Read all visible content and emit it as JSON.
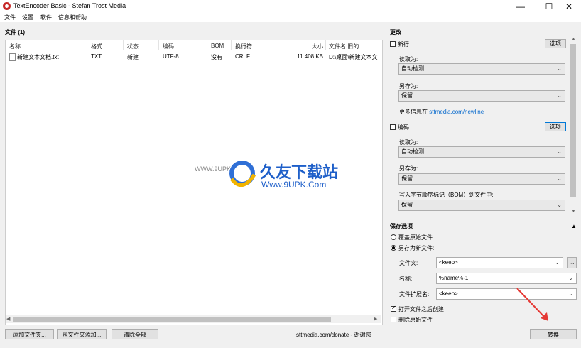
{
  "window": {
    "title": "TextEncoder Basic - Stefan Trost Media",
    "minimize": "—",
    "maximize": "☐",
    "close": "✕"
  },
  "menu": [
    "文件",
    "设置",
    "软件",
    "信息和帮助"
  ],
  "files": {
    "header": "文件 (1)",
    "columns": [
      "名称",
      "格式",
      "状态",
      "编码",
      "BOM",
      "换行符",
      "大小",
      "文件名 旧的"
    ],
    "rows": [
      {
        "name": "新建文本文档.txt",
        "format": "TXT",
        "status": "新建",
        "encoding": "UTF-8",
        "bom": "没有",
        "newline": "CRLF",
        "size": "11.408 KB",
        "oldname": "D:\\桌面\\新建文本文"
      }
    ]
  },
  "bottom": {
    "add_files": "添加文件夹...",
    "add_from_folder": "从文件夹添加...",
    "clear_all": "清除全部",
    "donate": "sttmedia.com/donate - 谢谢您",
    "convert": "转换"
  },
  "changes": {
    "header": "更改",
    "newline": {
      "label": "新行",
      "checked": false,
      "options_btn": "选项",
      "read_label": "读取为:",
      "read_value": "自动检测",
      "save_label": "另存为:",
      "save_value": "保留",
      "more_info_prefix": "更多信息在",
      "more_info_link": "sttmedia.com/newline"
    },
    "encoding": {
      "label": "编码",
      "checked": false,
      "options_btn": "选项",
      "read_label": "读取为:",
      "read_value": "自动检测",
      "save_label": "另存为:",
      "save_value": "保留",
      "bom_label": "写入字节顺序标记（BOM）到文件中:",
      "bom_value": "保留"
    }
  },
  "save": {
    "header": "保存选项",
    "collapse_icon": "▲",
    "overwrite": "覆盖原始文件",
    "save_new": "另存为新文件:",
    "selected": "save_new",
    "folder_label": "文件夹:",
    "folder_value": "<keep>",
    "browse": "...",
    "name_label": "名称:",
    "name_value": "%name%-1",
    "ext_label": "文件扩展名:",
    "ext_value": "<keep>",
    "open_after": "打开文件之后创建",
    "open_after_checked": true,
    "delete_original": "删除原始文件",
    "delete_original_checked": false
  },
  "watermark": {
    "url_left": "WWW.9UPK.COM",
    "brand": "久友下载站",
    "url": "Www.9UPK.Com"
  },
  "colors": {
    "accent": "#0066cc",
    "arrow": "#e53935",
    "app_icon": "#c62828"
  }
}
